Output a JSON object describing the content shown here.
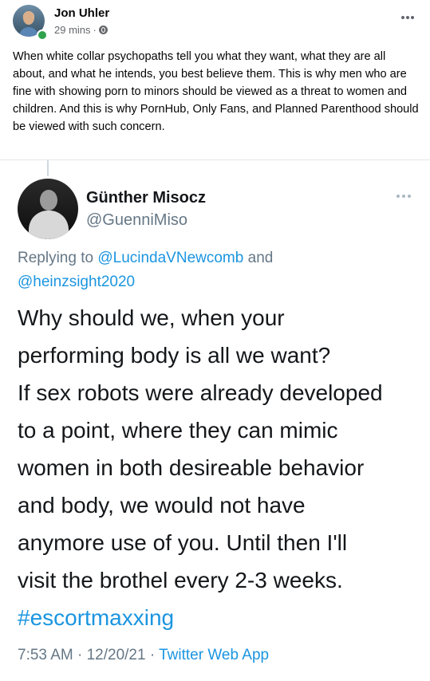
{
  "post": {
    "author": "Jon Uhler",
    "time": "29 mins",
    "separator": "·",
    "privacy_icon": "globe-icon",
    "more_icon": "more-horizontal-icon",
    "text": "When white collar psychopaths tell you what they want, what they are all about, and what he intends, you best believe them. This is why men who are fine with showing porn to minors should be viewed as a threat to women and children. And this is why PornHub, Only Fans, and Planned Parenthood should be viewed with such concern."
  },
  "tweet": {
    "name": "Günther Misocz",
    "handle": "@GuenniMiso",
    "reply_prefix": "Replying to",
    "mention_1": "@LucindaVNewcomb",
    "reply_and": "and",
    "mention_2": "@heinzsight2020",
    "lines": [
      "Why should we, when your",
      "performing body is all we want?",
      "If sex robots were already developed",
      "to a point, where they can mimic",
      "women in both desireable behavior",
      "and body, we would not have",
      "anymore use of you. Until then I'll",
      "visit the brothel every 2-3 weeks."
    ],
    "hashtag": "#escortmaxxing",
    "timestamp": "7:53 AM · 12/20/21 ·",
    "source": "Twitter Web App"
  },
  "colors": {
    "link": "#1b95e0",
    "muted": "#657786",
    "online": "#31a24c"
  }
}
